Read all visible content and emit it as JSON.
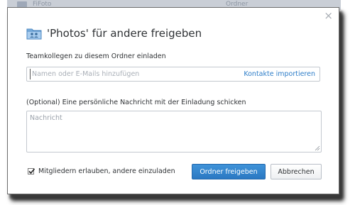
{
  "background": {
    "left_text": "FiFoto",
    "right_text": "Ordner"
  },
  "dialog": {
    "title": "'Photos' für andere freigeben",
    "invite_label": "Teamkollegen zu diesem Ordner einladen",
    "invite_placeholder": "Namen oder E-Mails hinzufügen",
    "import_contacts": "Kontakte importieren",
    "message_label": "(Optional) Eine persönliche Nachricht mit der Einladung schicken",
    "message_placeholder": "Nachricht",
    "allow_members_label": "Mitgliedern erlauben, andere einzuladen",
    "allow_members_checked": true,
    "share_button": "Ordner freigeben",
    "cancel_button": "Abbrechen",
    "close_glyph": "×"
  },
  "colors": {
    "primary": "#2a78c2",
    "link": "#2d7dc8",
    "folder_icon": "#5b9bd5"
  }
}
